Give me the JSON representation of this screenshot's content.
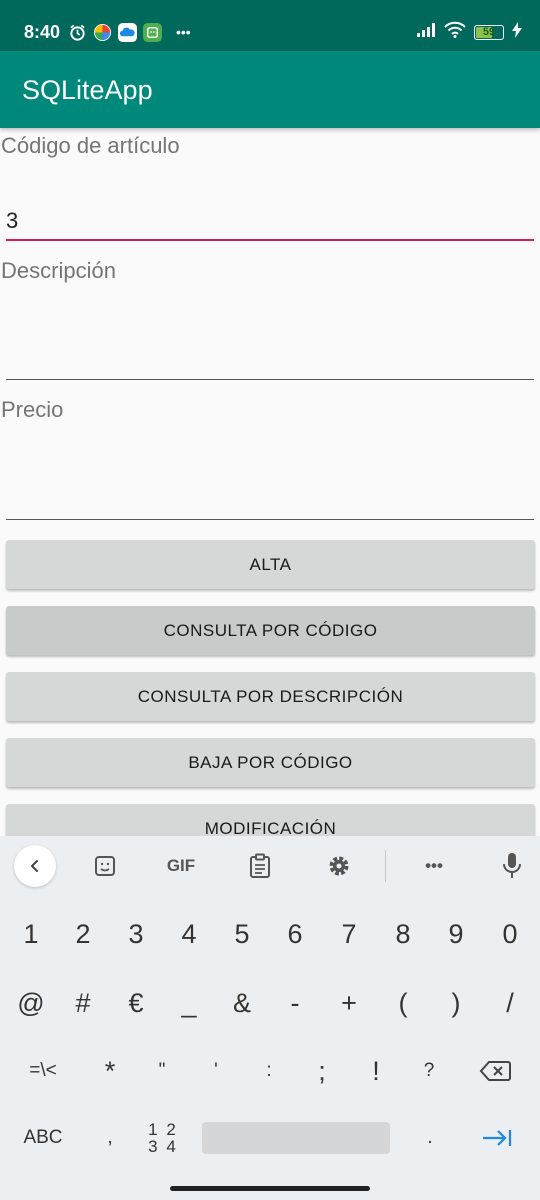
{
  "status_bar": {
    "time": "8:40",
    "battery": "59",
    "more": "•••"
  },
  "app": {
    "title": "SQLiteApp"
  },
  "form": {
    "codigo": {
      "label": "Código de artículo",
      "value": "3"
    },
    "descripcion": {
      "label": "Descripción",
      "value": ""
    },
    "precio": {
      "label": "Precio",
      "value": ""
    }
  },
  "buttons": [
    {
      "label": "ALTA"
    },
    {
      "label": "CONSULTA POR CÓDIGO"
    },
    {
      "label": "CONSULTA POR DESCRIPCIÓN"
    },
    {
      "label": "BAJA POR CÓDIGO"
    },
    {
      "label": "MODIFICACIÓN"
    }
  ],
  "keyboard": {
    "toolbar": {
      "gif": "GIF",
      "more": "•••"
    },
    "row1": [
      "1",
      "2",
      "3",
      "4",
      "5",
      "6",
      "7",
      "8",
      "9",
      "0"
    ],
    "row2": [
      "@",
      "#",
      "€",
      "_",
      "&",
      "-",
      "+",
      "(",
      ")",
      "/"
    ],
    "row3": [
      "=\\<",
      "*",
      "\"",
      "'",
      ":",
      ";",
      "!",
      "?"
    ],
    "row4": {
      "abc": "ABC",
      "comma": ",",
      "numpad_top": "1 2",
      "numpad_bottom": "3 4",
      "period": "."
    }
  },
  "colors": {
    "primary": "#00897b",
    "primary_dark": "#00695c",
    "accent": "#d81b60",
    "enter": "#1e88e5"
  }
}
